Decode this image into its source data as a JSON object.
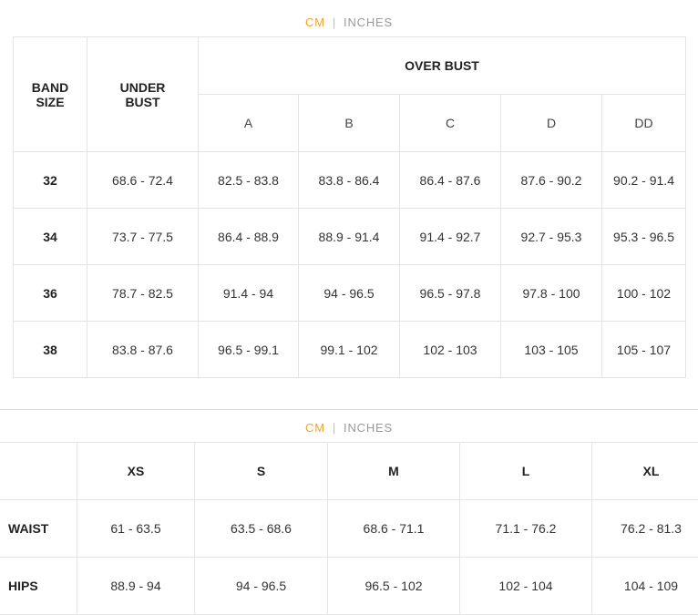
{
  "bra_chart": {
    "unit_toggle": {
      "cm": "CM",
      "separator": "|",
      "inches": "INCHES"
    },
    "headers": {
      "band_size": [
        "BAND",
        "SIZE"
      ],
      "under_bust": [
        "UNDER",
        "BUST"
      ],
      "over_bust": "OVER BUST",
      "cups": [
        "A",
        "B",
        "C",
        "D",
        "DD"
      ]
    },
    "rows": [
      {
        "band": "32",
        "under": "68.6 - 72.4",
        "cups": [
          "82.5 - 83.8",
          "83.8 - 86.4",
          "86.4 - 87.6",
          "87.6 - 90.2",
          "90.2 - 91.4"
        ]
      },
      {
        "band": "34",
        "under": "73.7 - 77.5",
        "cups": [
          "86.4 - 88.9",
          "88.9 - 91.4",
          "91.4 - 92.7",
          "92.7 - 95.3",
          "95.3 - 96.5"
        ]
      },
      {
        "band": "36",
        "under": "78.7 - 82.5",
        "cups": [
          "91.4 - 94",
          "94 - 96.5",
          "96.5 - 97.8",
          "97.8 - 100",
          "100 - 102"
        ]
      },
      {
        "band": "38",
        "under": "83.8 - 87.6",
        "cups": [
          "96.5 - 99.1",
          "99.1 - 102",
          "102 - 103",
          "103 - 105",
          "105 - 107"
        ]
      }
    ]
  },
  "size_chart": {
    "unit_toggle": {
      "cm": "CM",
      "separator": "|",
      "inches": "INCHES"
    },
    "sizes": [
      "XS",
      "S",
      "M",
      "L",
      "XL"
    ],
    "rows": [
      {
        "label": "WAIST",
        "values": [
          "61 - 63.5",
          "63.5 - 68.6",
          "68.6 - 71.1",
          "71.1 - 76.2",
          "76.2 - 81.3"
        ]
      },
      {
        "label": "HIPS",
        "values": [
          "88.9 - 94",
          "94 - 96.5",
          "96.5 - 102",
          "102 - 104",
          "104 - 109"
        ]
      }
    ]
  },
  "colors": {
    "active_unit": "#f0a431",
    "inactive_unit": "#999999",
    "border": "#e4e4e4"
  }
}
